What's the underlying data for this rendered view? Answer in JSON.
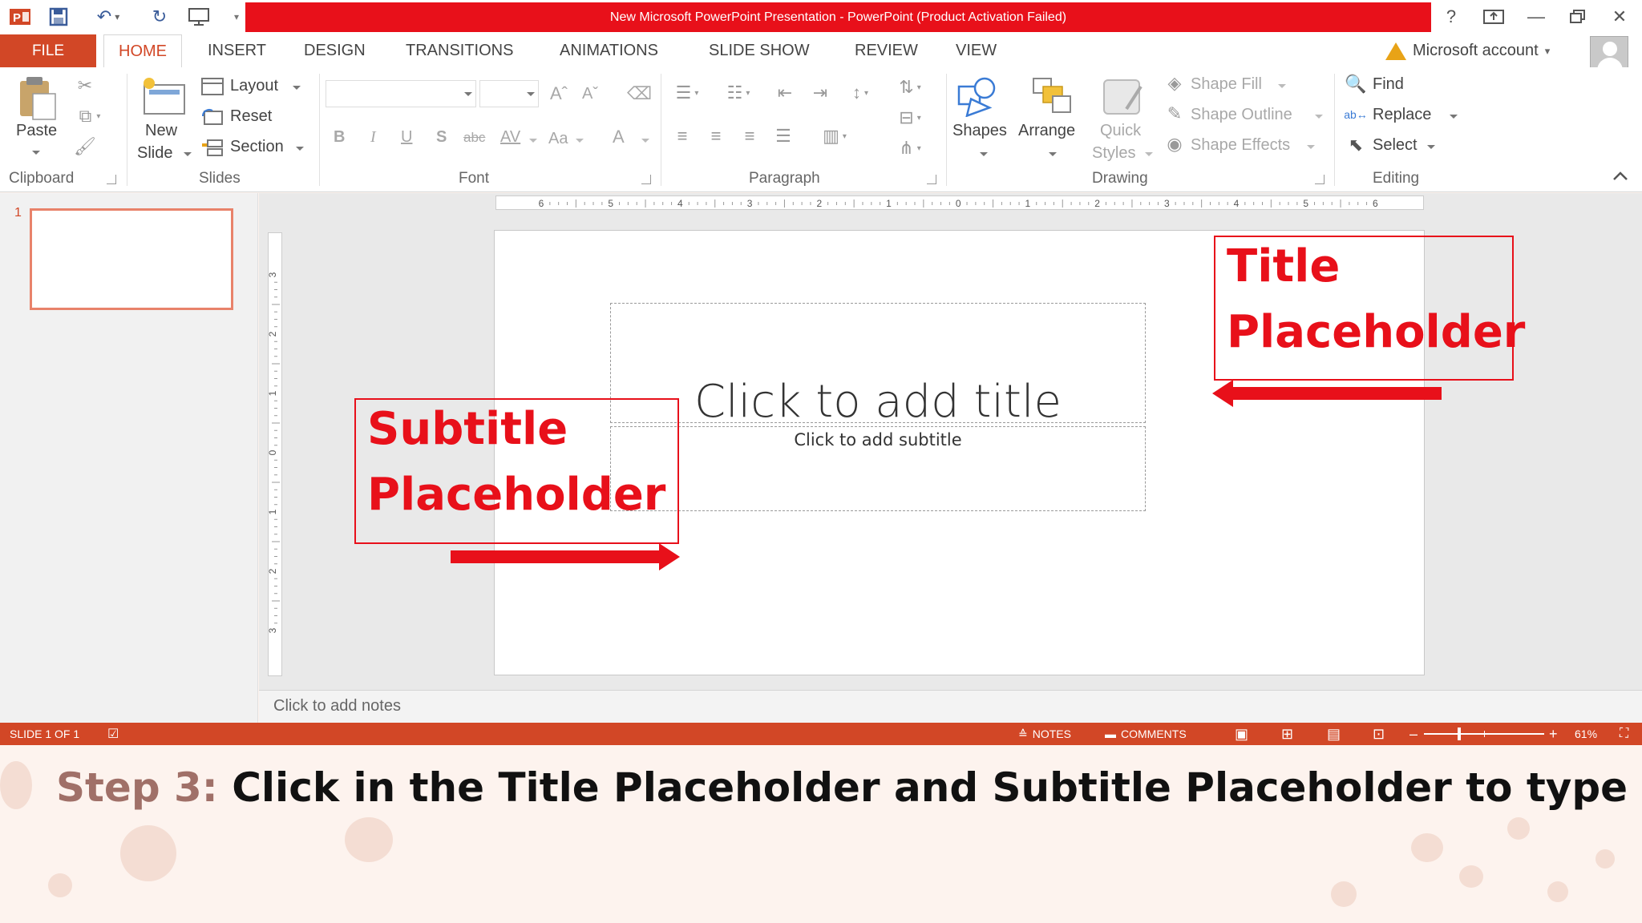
{
  "window": {
    "title": "New Microsoft PowerPoint Presentation -  PowerPoint (Product Activation Failed)",
    "help": "?"
  },
  "tabs": {
    "file": "FILE",
    "items": [
      "HOME",
      "INSERT",
      "DESIGN",
      "TRANSITIONS",
      "ANIMATIONS",
      "SLIDE SHOW",
      "REVIEW",
      "VIEW"
    ],
    "account": "Microsoft account"
  },
  "ribbon": {
    "clipboard": {
      "paste": "Paste",
      "label": "Clipboard"
    },
    "slides": {
      "new_line1": "New",
      "new_line2": "Slide",
      "layout": "Layout",
      "reset": "Reset",
      "section": "Section",
      "label": "Slides"
    },
    "font": {
      "bold": "B",
      "italic": "I",
      "underline": "U",
      "shadow": "S",
      "strike": "abc",
      "spacing": "AV",
      "case": "Aa",
      "color": "A",
      "label": "Font"
    },
    "paragraph": {
      "label": "Paragraph"
    },
    "drawing": {
      "shapes": "Shapes",
      "arrange": "Arrange",
      "quick1": "Quick",
      "quick2": "Styles",
      "fill": "Shape Fill",
      "outline": "Shape Outline",
      "effects": "Shape Effects",
      "label": "Drawing"
    },
    "editing": {
      "find": "Find",
      "replace": "Replace",
      "select": "Select",
      "label": "Editing"
    }
  },
  "thumbnails": {
    "number": "1"
  },
  "ruler": {
    "h_ticks": [
      "6",
      "5",
      "4",
      "3",
      "2",
      "1",
      "0",
      "1",
      "2",
      "3",
      "4",
      "5",
      "6"
    ],
    "v_ticks": [
      "3",
      "2",
      "1",
      "0",
      "1",
      "2",
      "3"
    ]
  },
  "slide": {
    "title_placeholder": "Click to add title",
    "subtitle_placeholder": "Click to add subtitle"
  },
  "notes": {
    "placeholder": "Click to add notes"
  },
  "status": {
    "slide": "SLIDE 1 OF 1",
    "notes": "NOTES",
    "comments": "COMMENTS",
    "zoom": "61%"
  },
  "annotations": {
    "title_line1": "Title",
    "title_line2": "Placeholder",
    "subtitle_line1": "Subtitle",
    "subtitle_line2": "Placeholder",
    "color": "#e8101a"
  },
  "caption": {
    "step": "Step 3:",
    "text": " Click in the Title Placeholder and Subtitle Placeholder to type the text"
  },
  "colors": {
    "accent": "#d24726",
    "title_red": "#e8101a"
  }
}
